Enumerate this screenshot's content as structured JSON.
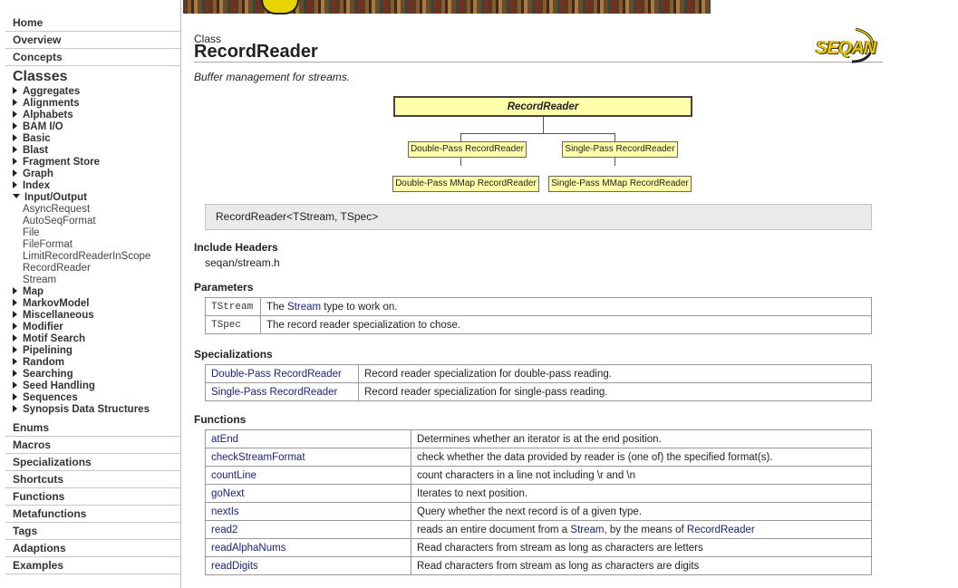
{
  "sidebar": {
    "top": [
      "Home",
      "Overview",
      "Concepts"
    ],
    "classes_heading": "Classes",
    "categories_before": [
      "Aggregates",
      "Alignments",
      "Alphabets",
      "BAM I/O",
      "Basic",
      "Blast",
      "Fragment Store",
      "Graph",
      "Index"
    ],
    "expanded_category": "Input/Output",
    "expanded_items": [
      "AsyncRequest",
      "AutoSeqFormat",
      "File",
      "FileFormat",
      "LimitRecordReaderInScope",
      "RecordReader",
      "Stream"
    ],
    "categories_after": [
      "Map",
      "MarkovModel",
      "Miscellaneous",
      "Modifier",
      "Motif Search",
      "Pipelining",
      "Random",
      "Searching",
      "Seed Handling",
      "Sequences",
      "Synopsis Data Structures"
    ],
    "bottom": [
      "Enums",
      "Macros",
      "Specializations",
      "Shortcuts",
      "Functions",
      "Metafunctions",
      "Tags",
      "Adaptions",
      "Examples"
    ]
  },
  "header": {
    "kicker": "Class",
    "title": "RecordReader",
    "subtitle": "Buffer management for streams.",
    "logo_text": "SEQAN"
  },
  "hierarchy": {
    "root": "RecordReader",
    "level1": [
      "Double-Pass RecordReader",
      "Single-Pass RecordReader"
    ],
    "level2": [
      "Double-Pass MMap RecordReader",
      "Single-Pass MMap RecordReader"
    ]
  },
  "signature": "RecordReader<TStream, TSpec>",
  "include": {
    "heading": "Include Headers",
    "value": "seqan/stream.h"
  },
  "parameters": {
    "heading": "Parameters",
    "rows": [
      {
        "name": "TStream",
        "pre": "The ",
        "link": "Stream",
        "post": " type to work on."
      },
      {
        "name": "TSpec",
        "pre": "The record reader specialization to chose.",
        "link": "",
        "post": ""
      }
    ]
  },
  "specializations": {
    "heading": "Specializations",
    "rows": [
      {
        "name": "Double-Pass RecordReader",
        "desc": "Record reader specialization for double-pass reading."
      },
      {
        "name": "Single-Pass RecordReader",
        "desc": "Record reader specialization for single-pass reading."
      }
    ]
  },
  "functions": {
    "heading": "Functions",
    "rows": [
      {
        "name": "atEnd",
        "desc": "Determines whether an iterator is at the end position."
      },
      {
        "name": "checkStreamFormat",
        "desc": "check whether the data provided by reader is (one of) the specified format(s)."
      },
      {
        "name": "countLine",
        "desc": "count characters in a line not including \\r and \\n"
      },
      {
        "name": "goNext",
        "desc": "Iterates to next position."
      },
      {
        "name": "nextIs",
        "desc": "Query whether the next record is of a given type."
      },
      {
        "name": "read2",
        "desc_pre": "reads an entire document from a ",
        "desc_link1": "Stream",
        "desc_mid": ", by the means of ",
        "desc_link2": "RecordReader"
      },
      {
        "name": "readAlphaNums",
        "desc": "Read characters from stream as long as characters are letters"
      },
      {
        "name": "readDigits",
        "desc": "Read characters from stream as long as characters are digits"
      }
    ]
  }
}
